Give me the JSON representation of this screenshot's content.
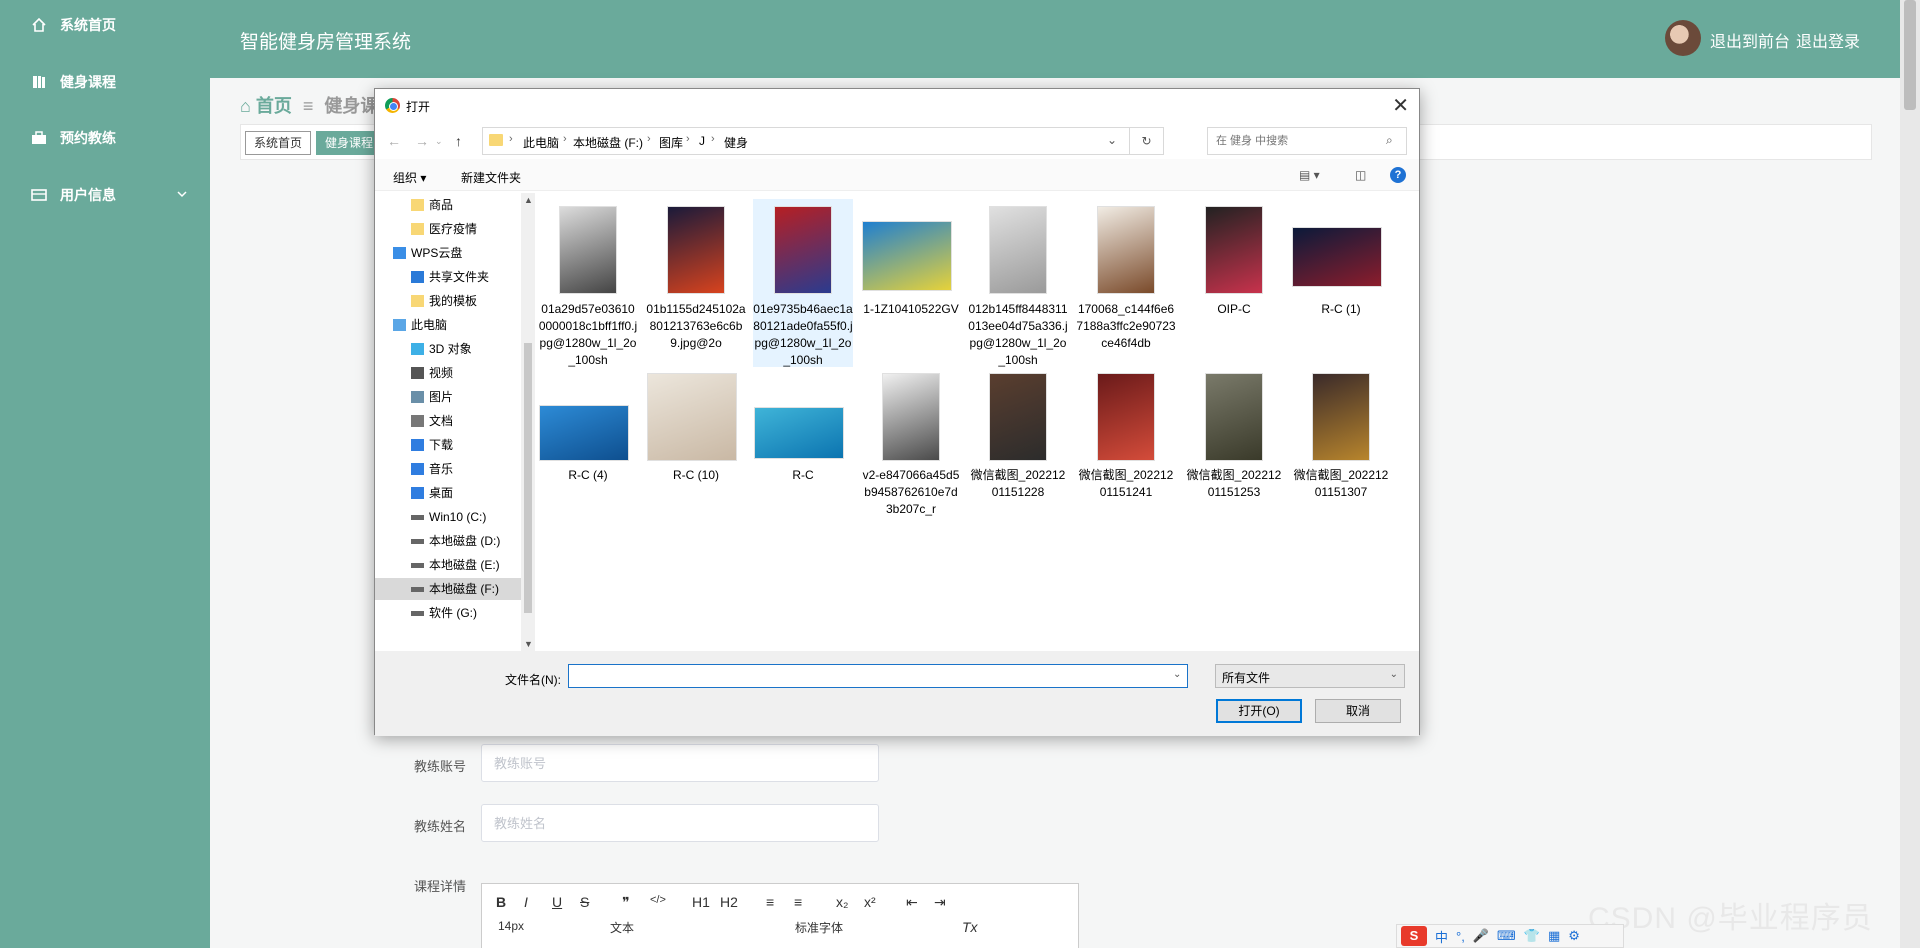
{
  "sidebar": {
    "items": [
      {
        "label": "系统首页",
        "icon": "home-icon"
      },
      {
        "label": "健身课程",
        "icon": "course-icon"
      },
      {
        "label": "预约教练",
        "icon": "briefcase-icon"
      },
      {
        "label": "用户信息",
        "icon": "user-card-icon"
      }
    ]
  },
  "header": {
    "title": "智能健身房管理系统",
    "front_link": "退出到前台",
    "logout_link": "退出登录"
  },
  "breadcrumb": {
    "home": "首页",
    "current": "健身课"
  },
  "tabs": [
    {
      "label": "系统首页"
    },
    {
      "label": "健身课程"
    }
  ],
  "form": {
    "coach_account": {
      "label": "教练账号",
      "placeholder": "教练账号"
    },
    "coach_name": {
      "label": "教练姓名",
      "placeholder": "教练姓名"
    },
    "course_detail": {
      "label": "课程详情"
    }
  },
  "editor": {
    "row1": [
      "B",
      "I",
      "U",
      "S",
      "❞",
      "</>",
      "H1",
      "H2",
      "≡",
      "≡",
      "x₂",
      "x²",
      "⇤",
      "⇥"
    ],
    "font_size": "14px",
    "text_style": "文本",
    "font_family": "标准字体",
    "clear_format": "Tx"
  },
  "watermark": "CSDN @毕业程序员",
  "ime": {
    "label": "中"
  },
  "dialog": {
    "title": "打开",
    "path": [
      "此电脑",
      "本地磁盘 (F:)",
      "图库",
      "J",
      "健身"
    ],
    "search_placeholder": "在 健身 中搜索",
    "organize": "组织 ▾",
    "new_folder": "新建文件夹",
    "nav_items": [
      {
        "label": "商品",
        "icon": "folder-icon"
      },
      {
        "label": "医疗疫情",
        "icon": "folder-icon"
      },
      {
        "label": "WPS云盘",
        "icon": "cloud-icon"
      },
      {
        "label": "共享文件夹",
        "icon": "share-icon"
      },
      {
        "label": "我的模板",
        "icon": "folder-icon"
      },
      {
        "label": "此电脑",
        "icon": "computer-icon"
      },
      {
        "label": "3D 对象",
        "icon": "cube-icon"
      },
      {
        "label": "视频",
        "icon": "video-icon"
      },
      {
        "label": "图片",
        "icon": "picture-icon"
      },
      {
        "label": "文档",
        "icon": "document-icon"
      },
      {
        "label": "下载",
        "icon": "download-icon"
      },
      {
        "label": "音乐",
        "icon": "music-icon"
      },
      {
        "label": "桌面",
        "icon": "desktop-icon"
      },
      {
        "label": "Win10 (C:)",
        "icon": "drive-icon"
      },
      {
        "label": "本地磁盘 (D:)",
        "icon": "drive-icon"
      },
      {
        "label": "本地磁盘 (E:)",
        "icon": "drive-icon"
      },
      {
        "label": "本地磁盘 (F:)",
        "icon": "drive-icon"
      },
      {
        "label": "软件 (G:)",
        "icon": "drive-icon"
      }
    ],
    "files": [
      {
        "name": "01a29d57e036100000018c1bff1ff0.jpg@1280w_1l_2o_100sh",
        "colors": [
          "#dcdcdc",
          "#444"
        ]
      },
      {
        "name": "01b1155d245102a801213763e6c6b9.jpg@2o",
        "colors": [
          "#1a1a3a",
          "#d8431e"
        ]
      },
      {
        "name": "01e9735b46aec1a80121ade0fa55f0.jpg@1280w_1l_2o_100sh",
        "colors": [
          "#b61f23",
          "#2a3b8f"
        ]
      },
      {
        "name": "1-1Z10410522GV",
        "colors": [
          "#1f7fd0",
          "#e6d23a"
        ]
      },
      {
        "name": "012b145ff8448311013ee04d75a336.jpg@1280w_1l_2o_100sh",
        "colors": [
          "#e0e0e0",
          "#9a9a9a"
        ]
      },
      {
        "name": "170068_c144f6e67188a3ffc2e90723ce46f4db",
        "colors": [
          "#f1ece4",
          "#7a4a2a"
        ]
      },
      {
        "name": "OIP-C",
        "colors": [
          "#222",
          "#c8324c"
        ]
      },
      {
        "name": "R-C (1)",
        "colors": [
          "#0b1a3a",
          "#8c1d2c"
        ]
      },
      {
        "name": "R-C (4)",
        "colors": [
          "#2d8bd6",
          "#0e4f8f"
        ]
      },
      {
        "name": "R-C (10)",
        "colors": [
          "#ece6dc",
          "#c9b8a4"
        ]
      },
      {
        "name": "R-C",
        "colors": [
          "#3fb4d8",
          "#0c74b0"
        ]
      },
      {
        "name": "v2-e847066a45d5b9458762610e7d3b207c_r",
        "colors": [
          "#f0f0f0",
          "#4a4a4a"
        ]
      },
      {
        "name": "微信截图_20221201151228",
        "colors": [
          "#5a3e2f",
          "#2c2c2c"
        ]
      },
      {
        "name": "微信截图_20221201151241",
        "colors": [
          "#6a1a1a",
          "#d44c3a"
        ]
      },
      {
        "name": "微信截图_20221201151253",
        "colors": [
          "#7a7a6a",
          "#3a3a2a"
        ]
      },
      {
        "name": "微信截图_20221201151307",
        "colors": [
          "#3a2a2a",
          "#b8852c"
        ]
      }
    ],
    "filename_label": "文件名(N):",
    "filename_value": "",
    "filetype": "所有文件",
    "open_button": "打开(O)",
    "cancel_button": "取消"
  },
  "colors": {
    "brand": "#6aaa9b",
    "selection": "#e5f3ff",
    "accent": "#0078d7"
  }
}
